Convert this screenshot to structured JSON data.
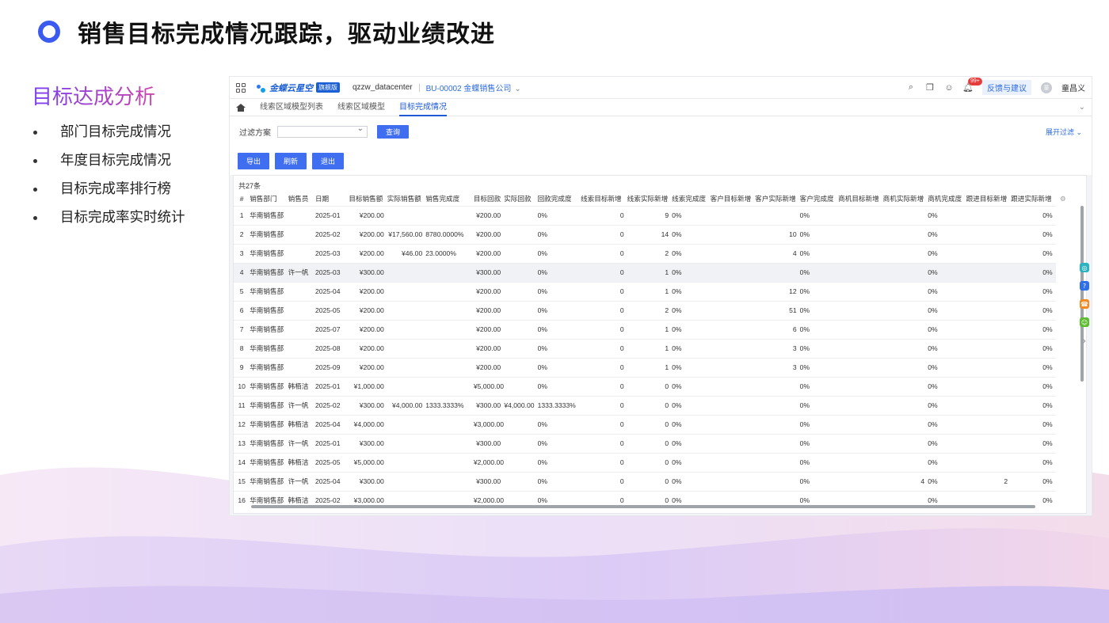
{
  "slide": {
    "title": "销售目标完成情况跟踪，驱动业绩改进",
    "section_title": "目标达成分析",
    "bullets": [
      "部门目标完成情况",
      "年度目标完成情况",
      "目标完成率排行榜",
      "目标完成率实时统计"
    ]
  },
  "app": {
    "logo_text": "金蝶云星空",
    "edition": "旗舰版",
    "tenant": "qzzw_datacenter",
    "org": "BU-00002 金蝶销售公司",
    "badge": "99+",
    "feedback": "反馈与建议",
    "avatar": "童",
    "username": "童昌义",
    "tabs": [
      "线索区域模型列表",
      "线索区域模型",
      "目标完成情况"
    ],
    "active_tab": 2,
    "filter_label": "过滤方案",
    "search_button": "查询",
    "expand_filter": "展开过滤 ⌄",
    "actions": [
      "导出",
      "刷新",
      "退出"
    ],
    "total": "共27条"
  },
  "table": {
    "headers": [
      "#",
      "销售部门",
      "销售员",
      "日期",
      "目标销售额",
      "实际销售额",
      "销售完成度",
      "目标回款",
      "实际回款",
      "回款完成度",
      "线索目标新增",
      "线索实际新增",
      "线索完成度",
      "客户目标新增",
      "客户实际新增",
      "客户完成度",
      "商机目标新增",
      "商机实际新增",
      "商机完成度",
      "跟进目标新增",
      "跟进实际新增"
    ],
    "rows": [
      [
        "1",
        "华南销售部",
        "",
        "2025-01",
        "¥200.00",
        "",
        "",
        "¥200.00",
        "",
        "0%",
        "0",
        "9",
        "0%",
        "",
        "",
        "0%",
        "",
        "",
        "0%",
        "",
        "0%"
      ],
      [
        "2",
        "华南销售部",
        "",
        "2025-02",
        "¥200.00",
        "¥17,560.00",
        "8780.0000%",
        "¥200.00",
        "",
        "0%",
        "0",
        "14",
        "0%",
        "",
        "10",
        "0%",
        "",
        "",
        "0%",
        "",
        "0%"
      ],
      [
        "3",
        "华南销售部",
        "",
        "2025-03",
        "¥200.00",
        "¥46.00",
        "23.0000%",
        "¥200.00",
        "",
        "0%",
        "0",
        "2",
        "0%",
        "",
        "4",
        "0%",
        "",
        "",
        "0%",
        "",
        "0%"
      ],
      [
        "4",
        "华南销售部",
        "许一帆",
        "2025-03",
        "¥300.00",
        "",
        "",
        "¥300.00",
        "",
        "0%",
        "0",
        "1",
        "0%",
        "",
        "",
        "0%",
        "",
        "",
        "0%",
        "",
        "0%"
      ],
      [
        "5",
        "华南销售部",
        "",
        "2025-04",
        "¥200.00",
        "",
        "",
        "¥200.00",
        "",
        "0%",
        "0",
        "1",
        "0%",
        "",
        "12",
        "0%",
        "",
        "",
        "0%",
        "",
        "0%"
      ],
      [
        "6",
        "华南销售部",
        "",
        "2025-05",
        "¥200.00",
        "",
        "",
        "¥200.00",
        "",
        "0%",
        "0",
        "2",
        "0%",
        "",
        "51",
        "0%",
        "",
        "",
        "0%",
        "",
        "0%"
      ],
      [
        "7",
        "华南销售部",
        "",
        "2025-07",
        "¥200.00",
        "",
        "",
        "¥200.00",
        "",
        "0%",
        "0",
        "1",
        "0%",
        "",
        "6",
        "0%",
        "",
        "",
        "0%",
        "",
        "0%"
      ],
      [
        "8",
        "华南销售部",
        "",
        "2025-08",
        "¥200.00",
        "",
        "",
        "¥200.00",
        "",
        "0%",
        "0",
        "1",
        "0%",
        "",
        "3",
        "0%",
        "",
        "",
        "0%",
        "",
        "0%"
      ],
      [
        "9",
        "华南销售部",
        "",
        "2025-09",
        "¥200.00",
        "",
        "",
        "¥200.00",
        "",
        "0%",
        "0",
        "1",
        "0%",
        "",
        "3",
        "0%",
        "",
        "",
        "0%",
        "",
        "0%"
      ],
      [
        "10",
        "华南销售部",
        "韩栢洁",
        "2025-01",
        "¥1,000.00",
        "",
        "",
        "¥5,000.00",
        "",
        "0%",
        "0",
        "0",
        "0%",
        "",
        "",
        "0%",
        "",
        "",
        "0%",
        "",
        "0%"
      ],
      [
        "11",
        "华南销售部",
        "许一帆",
        "2025-02",
        "¥300.00",
        "¥4,000.00",
        "1333.3333%",
        "¥300.00",
        "¥4,000.00",
        "1333.3333%",
        "0",
        "0",
        "0%",
        "",
        "",
        "0%",
        "",
        "",
        "0%",
        "",
        "0%"
      ],
      [
        "12",
        "华南销售部",
        "韩栢洁",
        "2025-04",
        "¥4,000.00",
        "",
        "",
        "¥3,000.00",
        "",
        "0%",
        "0",
        "0",
        "0%",
        "",
        "",
        "0%",
        "",
        "",
        "0%",
        "",
        "0%"
      ],
      [
        "13",
        "华南销售部",
        "许一帆",
        "2025-01",
        "¥300.00",
        "",
        "",
        "¥300.00",
        "",
        "0%",
        "0",
        "0",
        "0%",
        "",
        "",
        "0%",
        "",
        "",
        "0%",
        "",
        "0%"
      ],
      [
        "14",
        "华南销售部",
        "韩栢洁",
        "2025-05",
        "¥5,000.00",
        "",
        "",
        "¥2,000.00",
        "",
        "0%",
        "0",
        "0",
        "0%",
        "",
        "",
        "0%",
        "",
        "",
        "0%",
        "",
        "0%"
      ],
      [
        "15",
        "华南销售部",
        "许一帆",
        "2025-04",
        "¥300.00",
        "",
        "",
        "¥300.00",
        "",
        "0%",
        "0",
        "0",
        "0%",
        "",
        "",
        "0%",
        "",
        "4",
        "0%",
        "2",
        "0%"
      ],
      [
        "16",
        "华南销售部",
        "韩栢洁",
        "2025-02",
        "¥3,000.00",
        "",
        "",
        "¥2,000.00",
        "",
        "0%",
        "0",
        "0",
        "0%",
        "",
        "",
        "0%",
        "",
        "",
        "0%",
        "",
        "0%"
      ]
    ],
    "highlighted_row": 3
  },
  "colors": {
    "accent": "#3b5bf0",
    "button": "#3f6ff0",
    "link": "#2d6be0"
  },
  "side_float": {
    "items": [
      {
        "icon": "support-icon",
        "color": "#2bb3c0"
      },
      {
        "icon": "help-icon",
        "color": "#2f6fe8"
      },
      {
        "icon": "service-icon",
        "color": "#f08a24"
      },
      {
        "icon": "smile-icon",
        "color": "#5cbb2e"
      }
    ]
  }
}
